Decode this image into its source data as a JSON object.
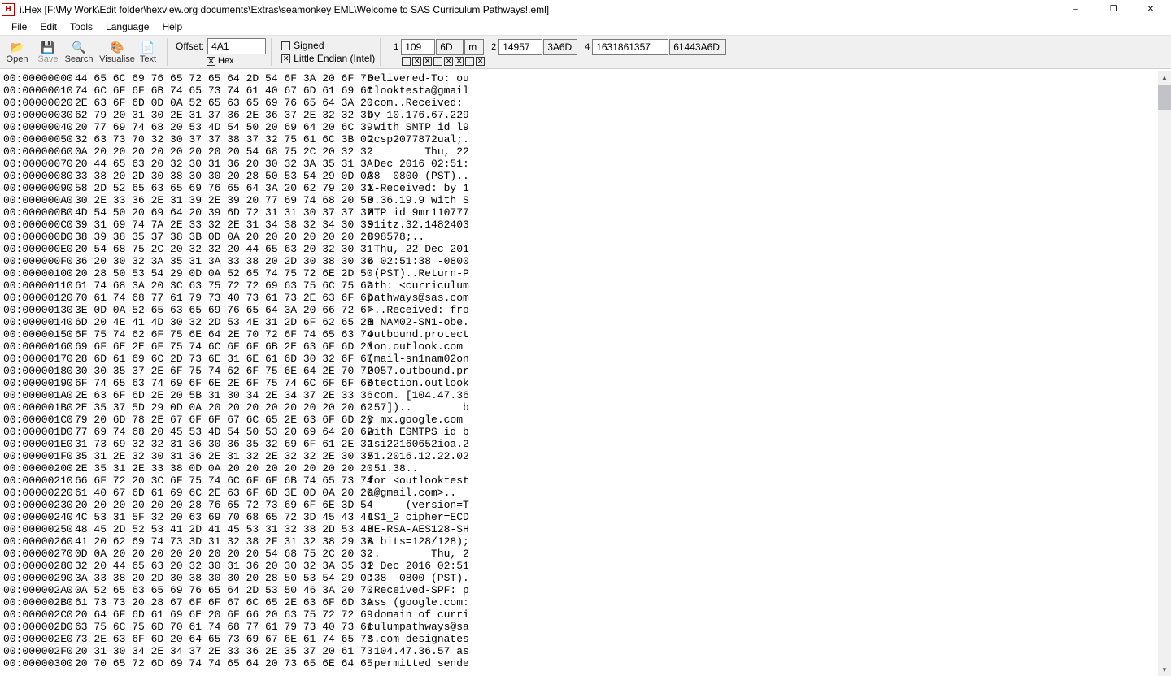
{
  "title": "i.Hex [F:\\My Work\\Edit folder\\hexview.org documents\\Extras\\seamonkey EML\\Welcome to SAS Curriculum Pathways!.eml]",
  "menus": [
    "File",
    "Edit",
    "Tools",
    "Language",
    "Help"
  ],
  "tools": {
    "open": "Open",
    "save": "Save",
    "search": "Search",
    "visualise": "Visualise",
    "text": "Text"
  },
  "offset": {
    "label": "Offset:",
    "value": "4A1",
    "hex_label": "Hex"
  },
  "endian": {
    "signed": "Signed",
    "little": "Little Endian (Intel)"
  },
  "vals": {
    "g1_label": "1",
    "g1_a": "109",
    "g1_b": "6D",
    "g1_c": "m",
    "g2_label": "2",
    "g2_a": "14957",
    "g2_b": "3A6D",
    "g4_label": "4",
    "g4_a": "1631861357",
    "g4_b": "61443A6D"
  },
  "hex_rows": [
    {
      "a": "00:00000000",
      "h": "44 65 6C 69 76 65 72 65 64 2D 54 6F 3A 20 6F 75",
      "t": "Delivered-To: ou"
    },
    {
      "a": "00:00000010",
      "h": "74 6C 6F 6F 6B 74 65 73 74 61 40 67 6D 61 69 6C",
      "t": "tlooktesta@gmail"
    },
    {
      "a": "00:00000020",
      "h": "2E 63 6F 6D 0D 0A 52 65 63 65 69 76 65 64 3A 20",
      "t": ".com..Received: "
    },
    {
      "a": "00:00000030",
      "h": "62 79 20 31 30 2E 31 37 36 2E 36 37 2E 32 32 39",
      "t": "by 10.176.67.229"
    },
    {
      "a": "00:00000040",
      "h": "20 77 69 74 68 20 53 4D 54 50 20 69 64 20 6C 39",
      "t": " with SMTP id l9"
    },
    {
      "a": "00:00000050",
      "h": "32 63 73 70 32 30 37 37 38 37 32 75 61 6C 3B 0D",
      "t": "2csp2077872ual;."
    },
    {
      "a": "00:00000060",
      "h": "0A 20 20 20 20 20 20 20 20 54 68 75 2C 20 32 32",
      "t": ".        Thu, 22"
    },
    {
      "a": "00:00000070",
      "h": "20 44 65 63 20 32 30 31 36 20 30 32 3A 35 31 3A",
      "t": " Dec 2016 02:51:"
    },
    {
      "a": "00:00000080",
      "h": "33 38 20 2D 30 38 30 30 20 28 50 53 54 29 0D 0A",
      "t": "38 -0800 (PST).."
    },
    {
      "a": "00:00000090",
      "h": "58 2D 52 65 63 65 69 76 65 64 3A 20 62 79 20 31",
      "t": "X-Received: by 1"
    },
    {
      "a": "00:000000A0",
      "h": "30 2E 33 36 2E 31 39 2E 39 20 77 69 74 68 20 53",
      "t": "0.36.19.9 with S"
    },
    {
      "a": "00:000000B0",
      "h": "4D 54 50 20 69 64 20 39 6D 72 31 31 30 37 37 37",
      "t": "MTP id 9mr110777"
    },
    {
      "a": "00:000000C0",
      "h": "39 31 69 74 7A 2E 33 32 2E 31 34 38 32 34 30 33",
      "t": "91itz.32.1482403"
    },
    {
      "a": "00:000000D0",
      "h": "38 39 38 35 37 38 3B 0D 0A 20 20 20 20 20 20 20",
      "t": "898578;..       "
    },
    {
      "a": "00:000000E0",
      "h": "20 54 68 75 2C 20 32 32 20 44 65 63 20 32 30 31",
      "t": " Thu, 22 Dec 201"
    },
    {
      "a": "00:000000F0",
      "h": "36 20 30 32 3A 35 31 3A 33 38 20 2D 30 38 30 30",
      "t": "6 02:51:38 -0800"
    },
    {
      "a": "00:00000100",
      "h": "20 28 50 53 54 29 0D 0A 52 65 74 75 72 6E 2D 50",
      "t": " (PST)..Return-P"
    },
    {
      "a": "00:00000110",
      "h": "61 74 68 3A 20 3C 63 75 72 72 69 63 75 6C 75 6D",
      "t": "ath: <curriculum"
    },
    {
      "a": "00:00000120",
      "h": "70 61 74 68 77 61 79 73 40 73 61 73 2E 63 6F 6D",
      "t": "pathways@sas.com"
    },
    {
      "a": "00:00000130",
      "h": "3E 0D 0A 52 65 63 65 69 76 65 64 3A 20 66 72 6F",
      "t": ">..Received: fro"
    },
    {
      "a": "00:00000140",
      "h": "6D 20 4E 41 4D 30 32 2D 53 4E 31 2D 6F 62 65 2E",
      "t": "m NAM02-SN1-obe."
    },
    {
      "a": "00:00000150",
      "h": "6F 75 74 62 6F 75 6E 64 2E 70 72 6F 74 65 63 74",
      "t": "outbound.protect"
    },
    {
      "a": "00:00000160",
      "h": "69 6F 6E 2E 6F 75 74 6C 6F 6F 6B 2E 63 6F 6D 20",
      "t": "ion.outlook.com "
    },
    {
      "a": "00:00000170",
      "h": "28 6D 61 69 6C 2D 73 6E 31 6E 61 6D 30 32 6F 6E",
      "t": "(mail-sn1nam02on"
    },
    {
      "a": "00:00000180",
      "h": "30 30 35 37 2E 6F 75 74 62 6F 75 6E 64 2E 70 72",
      "t": "0057.outbound.pr"
    },
    {
      "a": "00:00000190",
      "h": "6F 74 65 63 74 69 6F 6E 2E 6F 75 74 6C 6F 6F 6B",
      "t": "otection.outlook"
    },
    {
      "a": "00:000001A0",
      "h": "2E 63 6F 6D 2E 20 5B 31 30 34 2E 34 37 2E 33 36",
      "t": ".com. [104.47.36"
    },
    {
      "a": "00:000001B0",
      "h": "2E 35 37 5D 29 0D 0A 20 20 20 20 20 20 20 20 62",
      "t": ".57])..        b"
    },
    {
      "a": "00:000001C0",
      "h": "79 20 6D 78 2E 67 6F 6F 67 6C 65 2E 63 6F 6D 20",
      "t": "y mx.google.com "
    },
    {
      "a": "00:000001D0",
      "h": "77 69 74 68 20 45 53 4D 54 50 53 20 69 64 20 62",
      "t": "with ESMTPS id b"
    },
    {
      "a": "00:000001E0",
      "h": "31 73 69 32 32 31 36 30 36 35 32 69 6F 61 2E 32",
      "t": "1si22160652ioa.2"
    },
    {
      "a": "00:000001F0",
      "h": "35 31 2E 32 30 31 36 2E 31 32 2E 32 32 2E 30 32",
      "t": "51.2016.12.22.02"
    },
    {
      "a": "00:00000200",
      "h": "2E 35 31 2E 33 38 0D 0A 20 20 20 20 20 20 20 20",
      "t": ".51.38..        "
    },
    {
      "a": "00:00000210",
      "h": "66 6F 72 20 3C 6F 75 74 6C 6F 6F 6B 74 65 73 74",
      "t": "for <outlooktest"
    },
    {
      "a": "00:00000220",
      "h": "61 40 67 6D 61 69 6C 2E 63 6F 6D 3E 0D 0A 20 20",
      "t": "a@gmail.com>..  "
    },
    {
      "a": "00:00000230",
      "h": "20 20 20 20 20 20 28 76 65 72 73 69 6F 6E 3D 54",
      "t": "      (version=T"
    },
    {
      "a": "00:00000240",
      "h": "4C 53 31 5F 32 20 63 69 70 68 65 72 3D 45 43 44",
      "t": "LS1_2 cipher=ECD"
    },
    {
      "a": "00:00000250",
      "h": "48 45 2D 52 53 41 2D 41 45 53 31 32 38 2D 53 48",
      "t": "HE-RSA-AES128-SH"
    },
    {
      "a": "00:00000260",
      "h": "41 20 62 69 74 73 3D 31 32 38 2F 31 32 38 29 3B",
      "t": "A bits=128/128);"
    },
    {
      "a": "00:00000270",
      "h": "0D 0A 20 20 20 20 20 20 20 20 54 68 75 2C 20 32",
      "t": "..        Thu, 2"
    },
    {
      "a": "00:00000280",
      "h": "32 20 44 65 63 20 32 30 31 36 20 30 32 3A 35 31",
      "t": "2 Dec 2016 02:51"
    },
    {
      "a": "00:00000290",
      "h": "3A 33 38 20 2D 30 38 30 30 20 28 50 53 54 29 0D",
      "t": ":38 -0800 (PST)."
    },
    {
      "a": "00:000002A0",
      "h": "0A 52 65 63 65 69 76 65 64 2D 53 50 46 3A 20 70",
      "t": ".Received-SPF: p"
    },
    {
      "a": "00:000002B0",
      "h": "61 73 73 20 28 67 6F 6F 67 6C 65 2E 63 6F 6D 3A",
      "t": "ass (google.com:"
    },
    {
      "a": "00:000002C0",
      "h": "20 64 6F 6D 61 69 6E 20 6F 66 20 63 75 72 72 69",
      "t": " domain of curri"
    },
    {
      "a": "00:000002D0",
      "h": "63 75 6C 75 6D 70 61 74 68 77 61 79 73 40 73 61",
      "t": "culumpathways@sa"
    },
    {
      "a": "00:000002E0",
      "h": "73 2E 63 6F 6D 20 64 65 73 69 67 6E 61 74 65 73",
      "t": "s.com designates"
    },
    {
      "a": "00:000002F0",
      "h": "20 31 30 34 2E 34 37 2E 33 36 2E 35 37 20 61 73",
      "t": " 104.47.36.57 as"
    },
    {
      "a": "00:00000300",
      "h": "20 70 65 72 6D 69 74 74 65 64 20 73 65 6E 64 65",
      "t": " permitted sende"
    }
  ]
}
